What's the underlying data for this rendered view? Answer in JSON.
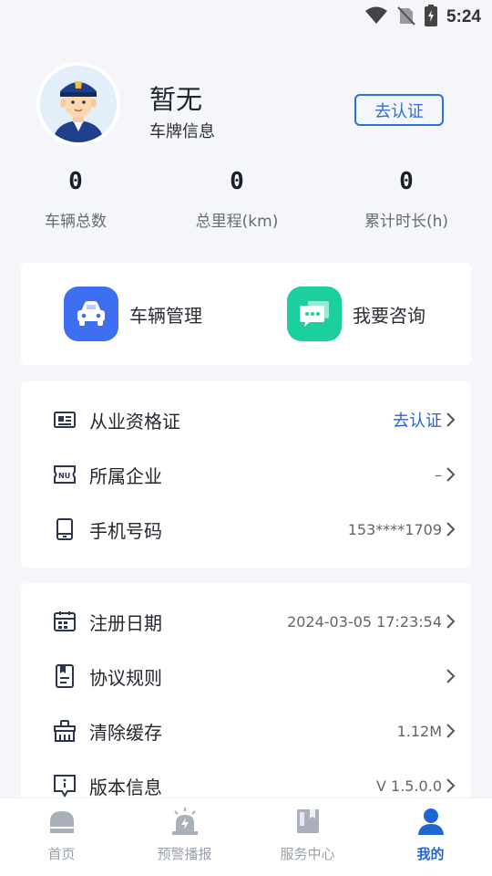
{
  "status": {
    "time": "5:24"
  },
  "profile": {
    "name": "暂无",
    "subtitle": "车牌信息",
    "certify_label": "去认证"
  },
  "stats": [
    {
      "value": "0",
      "label": "车辆总数"
    },
    {
      "value": "0",
      "label": "总里程(km)"
    },
    {
      "value": "0",
      "label": "累计时长(h)"
    }
  ],
  "actions": [
    {
      "label": "车辆管理",
      "icon": "car-icon",
      "color": "#3d6ff0"
    },
    {
      "label": "我要咨询",
      "icon": "chat-icon",
      "color": "#1ccf9e"
    }
  ],
  "info_list": [
    {
      "label": "从业资格证",
      "value": "去认证",
      "icon": "id-card-icon"
    },
    {
      "label": "所属企业",
      "value": "–",
      "icon": "enterprise-icon"
    },
    {
      "label": "手机号码",
      "value": "153****1709",
      "icon": "phone-icon"
    }
  ],
  "settings_list": [
    {
      "label": "注册日期",
      "value": "2024-03-05 17:23:54",
      "icon": "calendar-icon"
    },
    {
      "label": "协议规则",
      "value": "",
      "icon": "document-icon"
    },
    {
      "label": "清除缓存",
      "value": "1.12M",
      "icon": "broom-icon"
    },
    {
      "label": "版本信息",
      "value": "V 1.5.0.0",
      "icon": "info-icon"
    }
  ],
  "tabs": [
    {
      "label": "首页",
      "icon": "home-icon",
      "active": false
    },
    {
      "label": "预警播报",
      "icon": "alarm-icon",
      "active": false
    },
    {
      "label": "服务中心",
      "icon": "service-icon",
      "active": false
    },
    {
      "label": "我的",
      "icon": "user-icon",
      "active": true
    }
  ],
  "colors": {
    "accent": "#1f66d3",
    "background": "#f4f6f9",
    "inactive_tab": "#9aa0a9"
  }
}
